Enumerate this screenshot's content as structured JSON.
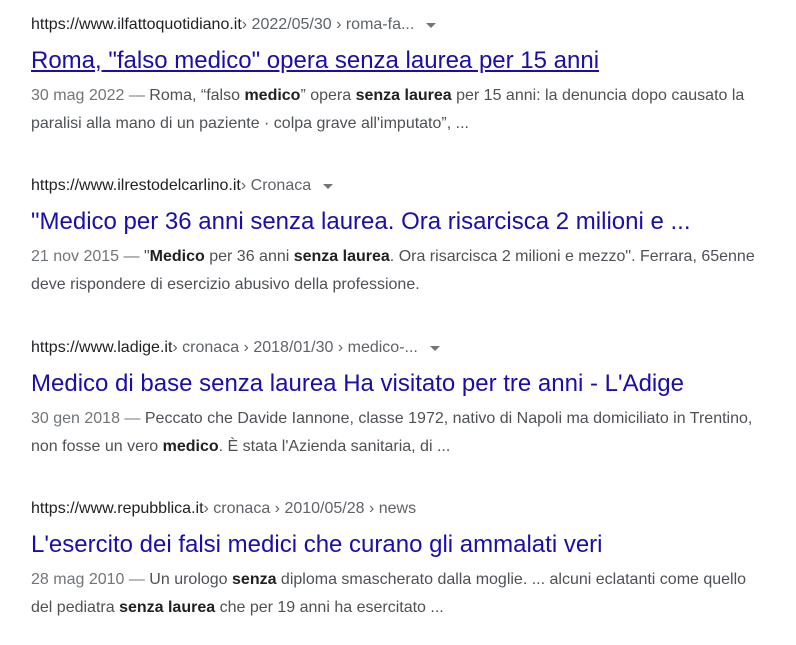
{
  "results": [
    {
      "domain": "https://www.ilfattoquotidiano.it",
      "path": " › 2022/05/30 › roma-fa...",
      "has_menu": true,
      "title": "Roma, \"falso medico\" opera senza laurea per 15 anni",
      "date": "30 mag 2022",
      "snippet": [
        {
          "t": "Roma, “falso "
        },
        {
          "b": "medico"
        },
        {
          "t": "” opera "
        },
        {
          "b": "senza laurea"
        },
        {
          "t": " per 15 anni: la denuncia dopo causato la paralisi alla mano di un paziente · colpa grave all'imputato”, ..."
        }
      ]
    },
    {
      "domain": "https://www.ilrestodelcarlino.it",
      "path": " › Cronaca",
      "has_menu": true,
      "title": "\"Medico per 36 anni senza laurea. Ora risarcisca 2 milioni e ...",
      "date": "21 nov 2015",
      "snippet": [
        {
          "t": "\""
        },
        {
          "b": "Medico"
        },
        {
          "t": " per 36 anni "
        },
        {
          "b": "senza laurea"
        },
        {
          "t": ". Ora risarcisca 2 milioni e mezzo\". Ferrara, 65enne deve rispondere di esercizio abusivo della professione."
        }
      ]
    },
    {
      "domain": "https://www.ladige.it",
      "path": " › cronaca › 2018/01/30 › medico-...",
      "has_menu": true,
      "title": "Medico di base senza laurea Ha visitato per tre anni - L'Adige",
      "date": "30 gen 2018",
      "snippet": [
        {
          "t": "Peccato che Davide Iannone, classe 1972, nativo di Napoli ma domiciliato in Trentino, non fosse un vero "
        },
        {
          "b": "medico"
        },
        {
          "t": ". È stata l'Azienda sanitaria, di ..."
        }
      ]
    },
    {
      "domain": "https://www.repubblica.it",
      "path": " › cronaca › 2010/05/28 › news",
      "has_menu": false,
      "title": "L'esercito dei falsi medici che curano gli ammalati veri",
      "date": "28 mag 2010",
      "snippet": [
        {
          "t": "Un urologo "
        },
        {
          "b": "senza"
        },
        {
          "t": " diploma smascherato dalla moglie. ... alcuni eclatanti come quello del pediatra "
        },
        {
          "b": "senza laurea"
        },
        {
          "t": " che per 19 anni ha esercitato ..."
        }
      ]
    }
  ],
  "date_separator": " — ",
  "colors": {
    "link": "#1a0dab",
    "url": "#202124",
    "path": "#5f6368",
    "snippet": "#4d5156",
    "date": "#70757a",
    "background": "#ffffff"
  },
  "icons": {
    "menu": "chevron-down-icon"
  }
}
